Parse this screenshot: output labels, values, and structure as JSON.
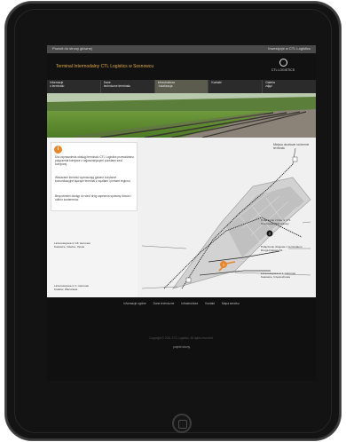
{
  "topbar": {
    "left": "Powrót do strony głównej",
    "right": "Inwestycje w CTL Logistics"
  },
  "banner": {
    "title": "Terminal Intermodalny CTL Logistics w Sosnowcu",
    "logo_text": "CTL LOGISTICS"
  },
  "nav": [
    {
      "line1": "Informacje",
      "line2": "o terminalu"
    },
    {
      "line1": "Dane",
      "line2": "techniczne terminalu"
    },
    {
      "line1": "Infrastruktura",
      "line2": "i lokalizacja"
    },
    {
      "line1": "Kontakt",
      "line2": ""
    },
    {
      "line1": "Galeria",
      "line2": "zdjęć"
    }
  ],
  "info_panel": {
    "badge": "i",
    "para1": "Dla usprawnienia obsługi terminalu CTL Logistics przewidziano połączenia kolejowe z najważniejszymi punktami sieci kolejowej.",
    "para2": "Wskazane kierunki wyznaczają główne korytarze komunikacyjne łączące terminal z węzłami i portami regionu.",
    "para3": "Bezpośredni dostęp do sieci dróg zapewnia sprawny dowóz i odbiór kontenerów."
  },
  "map": {
    "legend": "Miejsca docelowe na terenie terminalu",
    "labels": {
      "left_top": [
        "Linia kolejowa nr 18: kierunek",
        "Katowice, Gliwice, Opole"
      ],
      "left_bottom": [
        "Linia kolejowa nr 1: kierunek",
        "Kraków, Warszawa"
      ],
      "right_top": [
        "Połączenie z linią nr 171",
        "Sosnowiec Południowy"
      ],
      "right_middle": [
        "Połączenie drogowe z terminalem",
        "Droga krajowa S1"
      ],
      "right_bottom": [
        "Linia kolejowa nr 1: kierunek",
        "Katowice, Częstochowa"
      ]
    },
    "markers": {
      "orange": "1",
      "black": "2"
    }
  },
  "footer": {
    "links": [
      "Informacje ogólne",
      "Dane techniczne",
      "Infrastruktura",
      "Kontakt",
      "Mapa serwisu"
    ],
    "copyright": "Copyright © 2011 CTL Logistics. All rights reserved.",
    "credit": "projekt strony"
  },
  "colors": {
    "accent": "#e8872a",
    "title_gold": "#e0a84a",
    "nav_active": "#5b5b4e"
  }
}
